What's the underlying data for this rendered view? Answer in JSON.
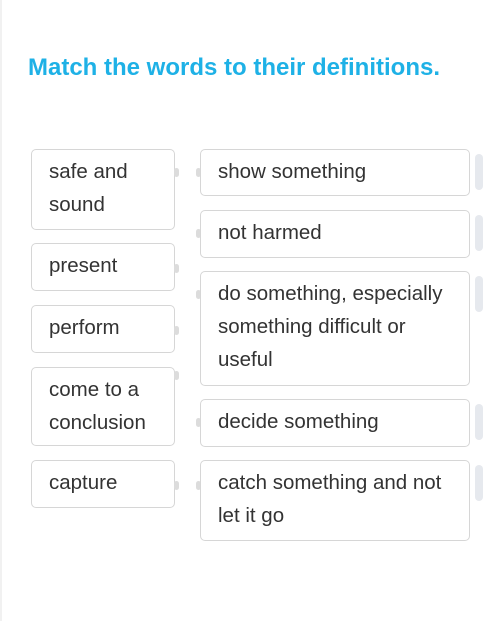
{
  "title": "Match the words to their definitions.",
  "words": [
    {
      "label": "safe and sound"
    },
    {
      "label": "present"
    },
    {
      "label": "perform"
    },
    {
      "label": "come to a conclusion"
    },
    {
      "label": "capture"
    }
  ],
  "definitions": [
    {
      "label": "show something"
    },
    {
      "label": "not harmed"
    },
    {
      "label": "do something, especially something difficult or useful"
    },
    {
      "label": "decide something"
    },
    {
      "label": "catch something and not let it go"
    }
  ],
  "colors": {
    "accent": "#1eb1e6",
    "text": "#333333",
    "border": "#d6d6d6"
  }
}
